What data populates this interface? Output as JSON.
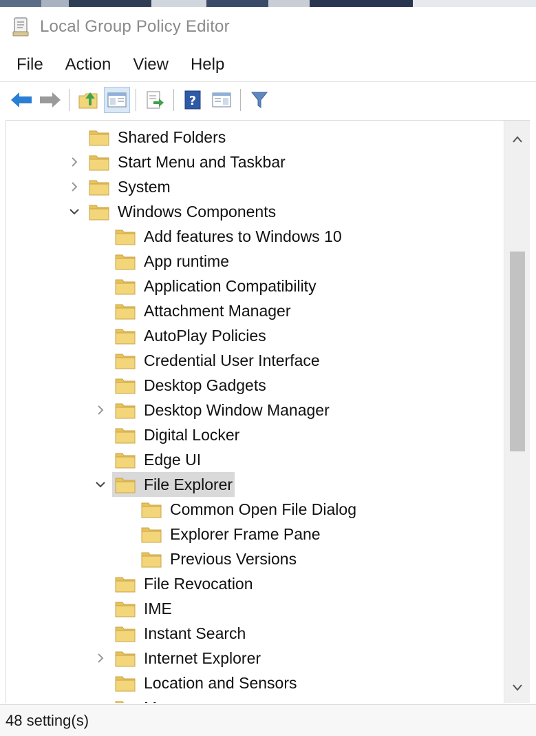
{
  "window": {
    "title": "Local Group Policy Editor",
    "title_icon": "policy-editor-icon"
  },
  "menu": {
    "file": "File",
    "action": "Action",
    "view": "View",
    "help": "Help"
  },
  "toolbar": {
    "buttons": [
      "back-arrow-icon",
      "forward-arrow-icon",
      "up-folder-icon",
      "show-hide-tree-icon",
      "export-list-icon",
      "help-icon",
      "properties-pane-icon",
      "filter-icon"
    ]
  },
  "tree": {
    "items": [
      {
        "label": "Shared Folders",
        "level": 1,
        "expander": "none"
      },
      {
        "label": "Start Menu and Taskbar",
        "level": 1,
        "expander": "collapsed"
      },
      {
        "label": "System",
        "level": 1,
        "expander": "collapsed"
      },
      {
        "label": "Windows Components",
        "level": 1,
        "expander": "expanded"
      },
      {
        "label": "Add features to Windows 10",
        "level": 2,
        "expander": "none"
      },
      {
        "label": "App runtime",
        "level": 2,
        "expander": "none"
      },
      {
        "label": "Application Compatibility",
        "level": 2,
        "expander": "none"
      },
      {
        "label": "Attachment Manager",
        "level": 2,
        "expander": "none"
      },
      {
        "label": "AutoPlay Policies",
        "level": 2,
        "expander": "none"
      },
      {
        "label": "Credential User Interface",
        "level": 2,
        "expander": "none"
      },
      {
        "label": "Desktop Gadgets",
        "level": 2,
        "expander": "none"
      },
      {
        "label": "Desktop Window Manager",
        "level": 2,
        "expander": "collapsed"
      },
      {
        "label": "Digital Locker",
        "level": 2,
        "expander": "none"
      },
      {
        "label": "Edge UI",
        "level": 2,
        "expander": "none"
      },
      {
        "label": "File Explorer",
        "level": 2,
        "expander": "expanded",
        "selected": true
      },
      {
        "label": "Common Open File Dialog",
        "level": 3,
        "expander": "none"
      },
      {
        "label": "Explorer Frame Pane",
        "level": 3,
        "expander": "none"
      },
      {
        "label": "Previous Versions",
        "level": 3,
        "expander": "none"
      },
      {
        "label": "File Revocation",
        "level": 2,
        "expander": "none"
      },
      {
        "label": "IME",
        "level": 2,
        "expander": "none"
      },
      {
        "label": "Instant Search",
        "level": 2,
        "expander": "none"
      },
      {
        "label": "Internet Explorer",
        "level": 2,
        "expander": "collapsed"
      },
      {
        "label": "Location and Sensors",
        "level": 2,
        "expander": "none"
      },
      {
        "label": "Maps",
        "level": 2,
        "expander": "none",
        "partial": true
      }
    ]
  },
  "status": {
    "text": "48 setting(s)"
  },
  "colors": {
    "folder_fill": "#f3d57a",
    "folder_tab": "#e8c25c",
    "selection": "#d9d9d9",
    "arrow_blue": "#2a7fd4"
  }
}
